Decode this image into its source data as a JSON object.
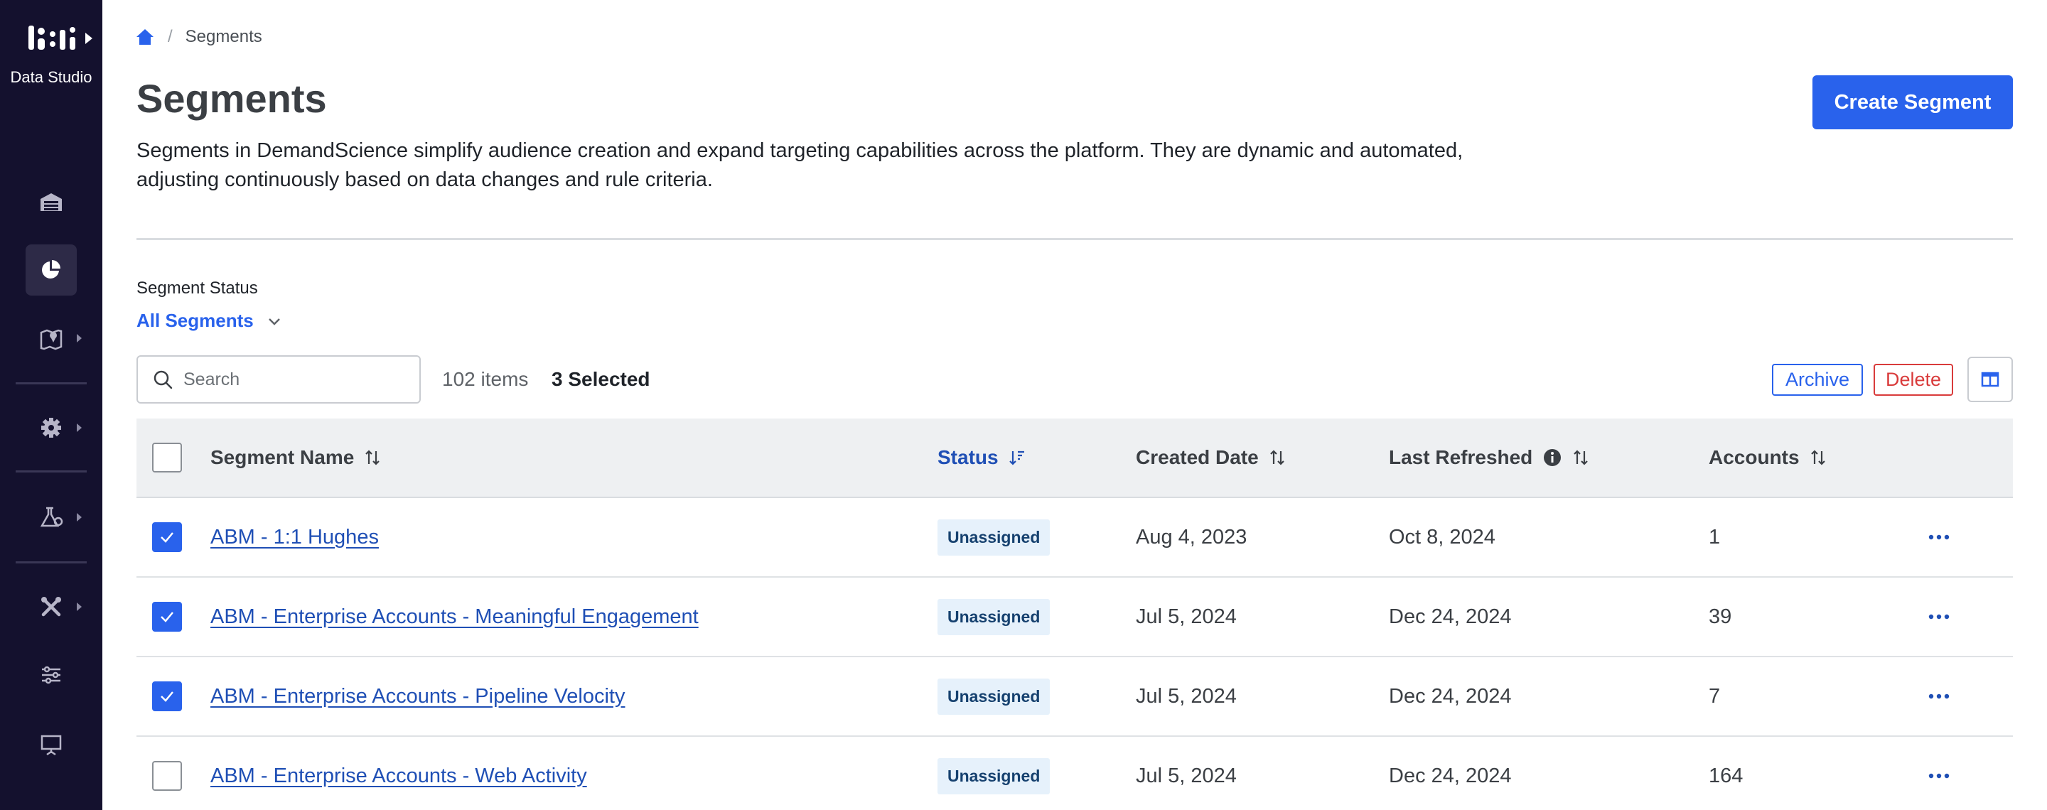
{
  "app": {
    "name": "Data Studio"
  },
  "breadcrumb": {
    "current": "Segments",
    "separator": "/"
  },
  "page": {
    "title": "Segments",
    "description": "Segments in DemandScience simplify audience creation and expand targeting capabilities across the platform. They are dynamic and automated, adjusting continuously based on data changes and rule criteria.",
    "create_label": "Create Segment"
  },
  "filter": {
    "label": "Segment Status",
    "value": "All Segments"
  },
  "toolbar": {
    "search_placeholder": "Search",
    "items_count": "102 items",
    "selected_count": "3 Selected",
    "archive_label": "Archive",
    "delete_label": "Delete"
  },
  "table": {
    "headers": {
      "name": "Segment Name",
      "status": "Status",
      "created": "Created Date",
      "refreshed": "Last Refreshed",
      "accounts": "Accounts"
    },
    "rows": [
      {
        "name": "ABM - 1:1 Hughes",
        "status": "Unassigned",
        "created": "Aug 4, 2023",
        "refreshed": "Oct 8, 2024",
        "accounts": "1",
        "checked": true
      },
      {
        "name": "ABM - Enterprise Accounts - Meaningful Engagement",
        "status": "Unassigned",
        "created": "Jul 5, 2024",
        "refreshed": "Dec 24, 2024",
        "accounts": "39",
        "checked": true
      },
      {
        "name": "ABM - Enterprise Accounts - Pipeline Velocity",
        "status": "Unassigned",
        "created": "Jul 5, 2024",
        "refreshed": "Dec 24, 2024",
        "accounts": "7",
        "checked": true
      },
      {
        "name": "ABM - Enterprise Accounts - Web Activity",
        "status": "Unassigned",
        "created": "Jul 5, 2024",
        "refreshed": "Dec 24, 2024",
        "accounts": "164",
        "checked": false
      }
    ]
  },
  "colors": {
    "sidebar": "#14112e",
    "primary": "#2962ec",
    "danger": "#d93b3b",
    "link": "#1f4fb5"
  },
  "icons": [
    "logo",
    "caret-right-icon",
    "warehouse-icon",
    "pie-chart-icon",
    "map-pin-icon",
    "gear-icon",
    "lab-icon",
    "tools-icon",
    "sliders-icon",
    "presentation-icon",
    "home-icon",
    "chevron-down-icon",
    "search-icon",
    "columns-icon",
    "sort-icon",
    "sort-desc-icon",
    "info-icon",
    "more-icon",
    "check-icon"
  ]
}
